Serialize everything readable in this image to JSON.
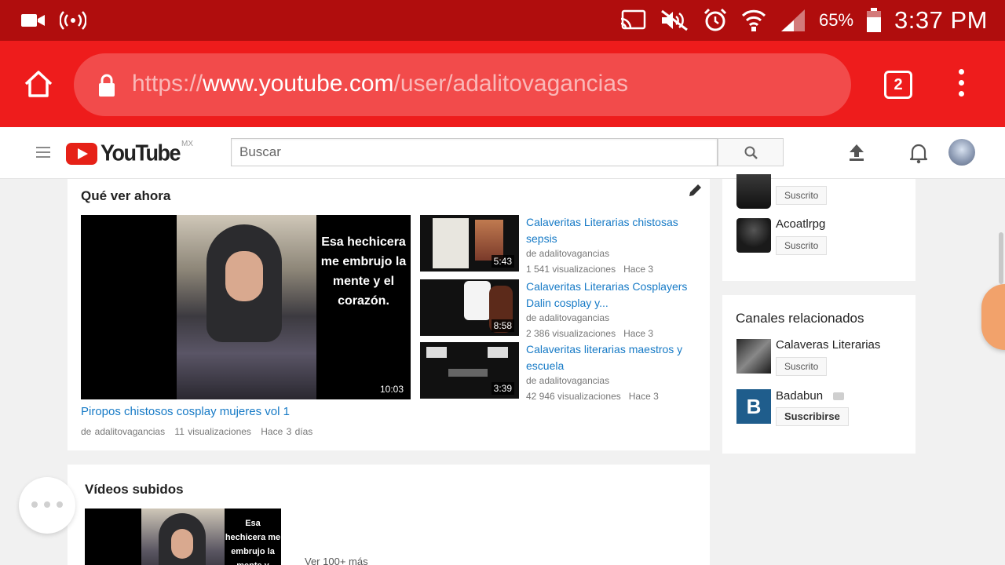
{
  "status_bar": {
    "battery_pct": "65%",
    "time": "3:37 PM"
  },
  "browser": {
    "url_scheme": "https://",
    "url_domain": "www.youtube.com",
    "url_path": "/user/adalitovagancias",
    "tab_count": "2"
  },
  "yt_header": {
    "logo_text": "YouTube",
    "region": "MX",
    "search_placeholder": "Buscar"
  },
  "whats_on": {
    "title": "Qué ver ahora",
    "featured": {
      "caption": "Esa hechicera me embrujo la mente y el corazón.",
      "duration": "10:03",
      "title": "Piropos chistosos cosplay mujeres vol 1",
      "channel": "de adalitovagancias",
      "views": "11 visualizaciones",
      "ago": "Hace 3 días"
    },
    "side_videos": [
      {
        "title": "Calaveritas Literarias chistosas sepsis",
        "channel": "de adalitovagancias",
        "views": "1 541 visualizaciones",
        "ago": "Hace 3",
        "duration": "5:43"
      },
      {
        "title": "Calaveritas Literarias Cosplayers Dalin cosplay y...",
        "channel": "de adalitovagancias",
        "views": "2 386 visualizaciones",
        "ago": "Hace 3",
        "duration": "8:58"
      },
      {
        "title": "Calaveritas literarias maestros y escuela",
        "channel": "de adalitovagancias",
        "views": "42 946 visualizaciones",
        "ago": "Hace 3",
        "duration": "3:39"
      }
    ]
  },
  "uploads": {
    "title": "Vídeos subidos",
    "caption": "Esa hechicera me embrujo la mente y",
    "see_more": "Ver 100+ más"
  },
  "subscriptions": {
    "channels": [
      {
        "name": "",
        "button": "Suscrito"
      },
      {
        "name": "Acoatlrpg",
        "button": "Suscrito"
      }
    ]
  },
  "related": {
    "title": "Canales relacionados",
    "channels": [
      {
        "name": "Calaveras Literarias",
        "button": "Suscrito"
      },
      {
        "name": "Badabun",
        "button": "Suscribirse"
      }
    ]
  },
  "colors": {
    "status_bar": "#b00d0d",
    "toolbar": "#ee1c1c",
    "link": "#167ac6",
    "yt_red": "#e62117"
  }
}
